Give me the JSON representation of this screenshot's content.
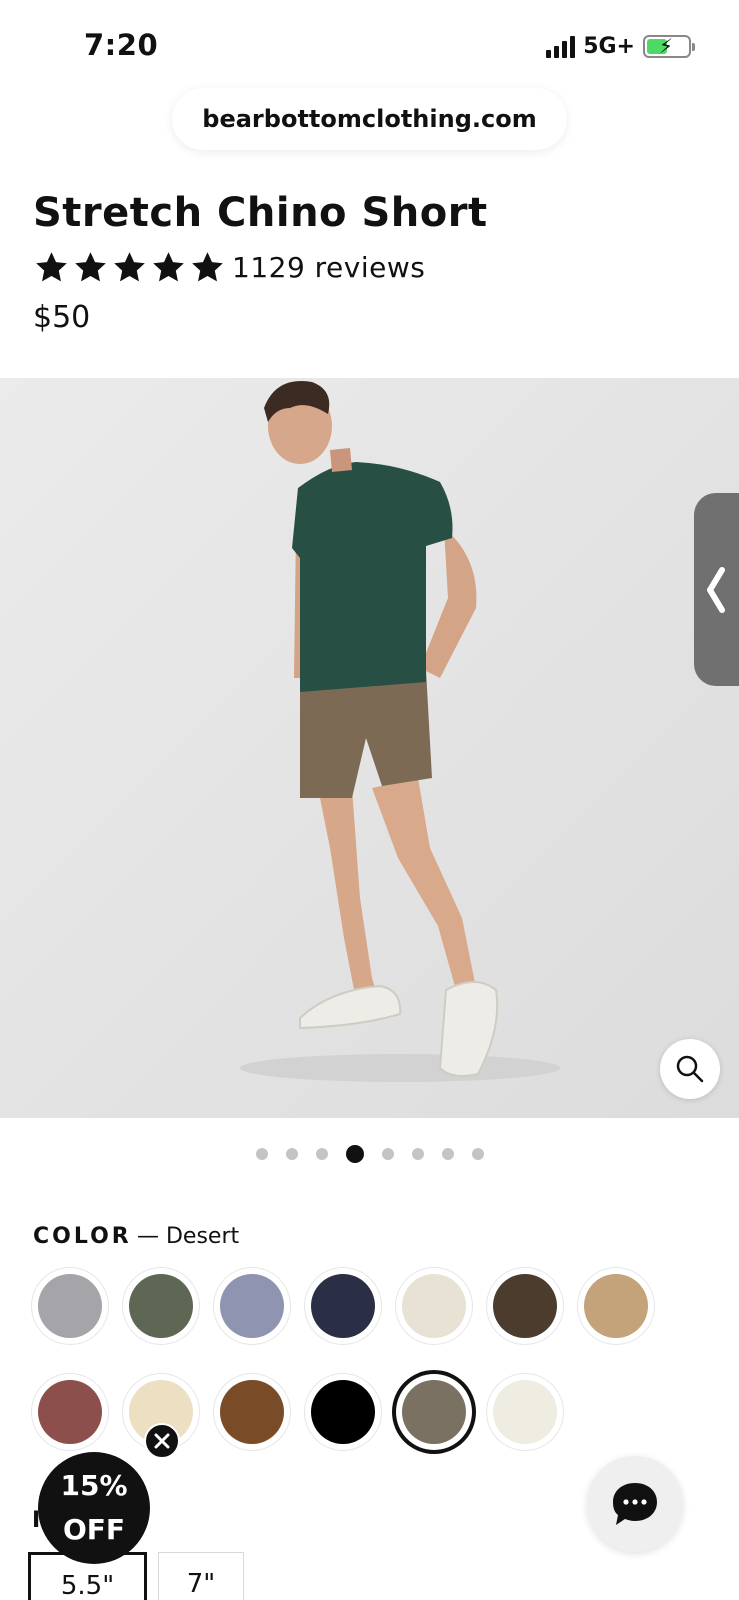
{
  "status_bar": {
    "time": "7:20",
    "network": "5G+",
    "battery_level": 0.5
  },
  "browser": {
    "url": "bearbottomclothing.com"
  },
  "product": {
    "title": "Stretch Chino Short",
    "rating_stars": 5,
    "review_count": "1129 reviews",
    "price": "$50"
  },
  "gallery": {
    "total_images": 8,
    "active_index": 3,
    "zoom_icon": "magnifier-icon",
    "side_tab_icon": "chevron-left-icon"
  },
  "color": {
    "label": "COLOR",
    "selected_text": "— Desert",
    "swatches": [
      {
        "color": "#a5a5a9"
      },
      {
        "color": "#5d6753"
      },
      {
        "color": "#8f95b1"
      },
      {
        "color": "#2a2f45"
      },
      {
        "color": "#e8e2d5"
      },
      {
        "color": "#4c3c2d"
      },
      {
        "color": "#c4a27a"
      },
      {
        "color": "#8c4f4c"
      },
      {
        "color": "#ede0c2"
      },
      {
        "color": "#7a4b27"
      },
      {
        "color": "#000000"
      },
      {
        "color": "#7b7163",
        "selected": true
      },
      {
        "color": "#efede1"
      }
    ]
  },
  "inseam": {
    "label": "I",
    "options": [
      {
        "label": "5.5\"",
        "selected": true
      },
      {
        "label": "7\"",
        "selected": false
      }
    ]
  },
  "promo": {
    "line1": "15%",
    "line2": "OFF",
    "close_icon": "close-icon"
  },
  "chat": {
    "icon": "chat-bubble-icon"
  },
  "colors": {
    "star": "#111111",
    "battery_fill": "#4cd964"
  }
}
